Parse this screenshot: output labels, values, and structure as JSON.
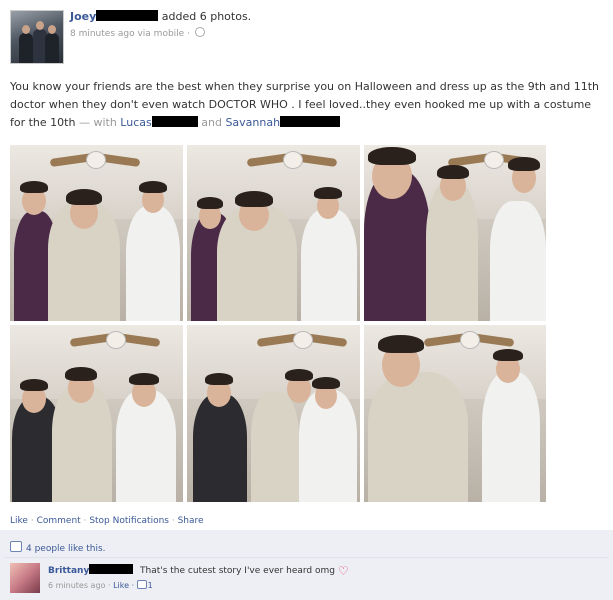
{
  "post": {
    "author": "Joey",
    "action": "added 6 photos.",
    "meta": "8 minutes ago via mobile ·",
    "text_main": "You know your friends are the best when they surprise you on Halloween and dress up as the 9th and 11th doctor when they don't even watch DOCTOR WHO . I feel loved..they even hooked me up with a costume for the 10th",
    "with_label": "— with",
    "tag1": "Lucas",
    "and_label": "and",
    "tag2": "Savannah"
  },
  "photos": [
    "photo-1",
    "photo-2",
    "photo-3",
    "photo-4",
    "photo-5",
    "photo-6"
  ],
  "actions": {
    "like": "Like",
    "comment": "Comment",
    "stop_notifications": "Stop Notifications",
    "share": "Share",
    "separator": "·"
  },
  "likes_text": "4 people like this.",
  "comment": {
    "author": "Brittany",
    "text": "That's the cutest story I've ever heard omg",
    "time": "6 minutes ago ·",
    "like": "Like ·",
    "like_count": "1"
  },
  "colors": {
    "link": "#3b5998",
    "meta": "#999999",
    "ufi_bg": "#edeff4"
  }
}
